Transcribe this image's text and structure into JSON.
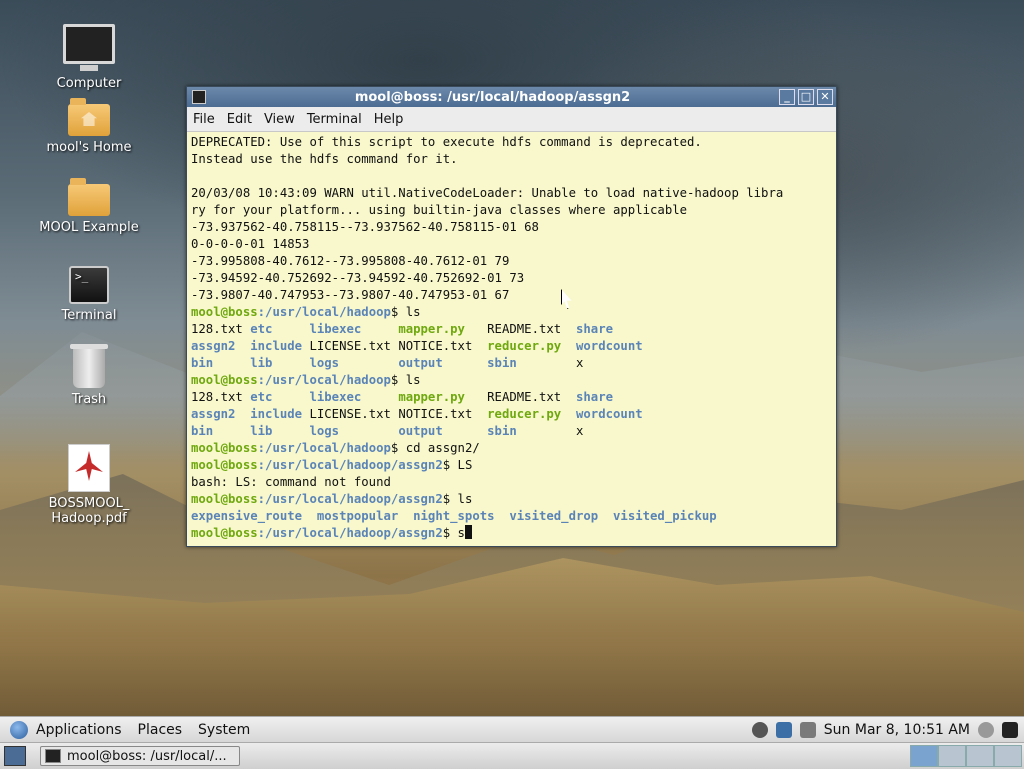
{
  "desktop": {
    "icons": [
      {
        "label": "Computer"
      },
      {
        "label": "mool's Home"
      },
      {
        "label": "MOOL Example"
      },
      {
        "label": "Terminal"
      },
      {
        "label": "Trash"
      },
      {
        "label": "BOSSMOOL_\nHadoop.pdf"
      }
    ]
  },
  "window": {
    "title": "mool@boss: /usr/local/hadoop/assgn2",
    "menu": [
      "File",
      "Edit",
      "View",
      "Terminal",
      "Help"
    ],
    "lines": [
      "DEPRECATED: Use of this script to execute hdfs command is deprecated.",
      "Instead use the hdfs command for it.",
      "",
      "20/03/08 10:43:09 WARN util.NativeCodeLoader: Unable to load native-hadoop libra",
      "ry for your platform... using builtin-java classes where applicable",
      "-73.937562-40.758115--73.937562-40.758115-01 68",
      "0-0-0-0-01 14853",
      "-73.995808-40.7612--73.995808-40.7612-01 79",
      "-73.94592-40.752692--73.94592-40.752692-01 73",
      "-73.9807-40.747953--73.9807-40.747953-01 67"
    ],
    "prompt_user": "mool@boss",
    "prompt_path1": ":/usr/local/hadoop",
    "prompt_path2": ":/usr/local/hadoop/assgn2",
    "cmd_ls": "$ ls",
    "cmd_cd": "$ cd assgn2/",
    "cmd_LS": "$ LS",
    "err_LS": "bash: LS: command not found",
    "cmd_cur": "$ s",
    "ls_hadoop": [
      [
        {
          "t": "128.txt ",
          "c": ""
        },
        {
          "t": "etc     ",
          "c": "b"
        },
        {
          "t": "libexec     ",
          "c": "b"
        },
        {
          "t": "mapper.py   ",
          "c": "g"
        },
        {
          "t": "README.txt  ",
          "c": ""
        },
        {
          "t": "share",
          "c": "b"
        }
      ],
      [
        {
          "t": "assgn2  ",
          "c": "b"
        },
        {
          "t": "include ",
          "c": "b"
        },
        {
          "t": "LICENSE.txt ",
          "c": ""
        },
        {
          "t": "NOTICE.txt  ",
          "c": ""
        },
        {
          "t": "reducer.py  ",
          "c": "g"
        },
        {
          "t": "wordcount",
          "c": "b"
        }
      ],
      [
        {
          "t": "bin     ",
          "c": "b"
        },
        {
          "t": "lib     ",
          "c": "b"
        },
        {
          "t": "logs        ",
          "c": "b"
        },
        {
          "t": "output      ",
          "c": "b"
        },
        {
          "t": "sbin        ",
          "c": "b"
        },
        {
          "t": "x",
          "c": ""
        }
      ]
    ],
    "ls_assgn2": [
      [
        {
          "t": "expensive_route  ",
          "c": "b"
        },
        {
          "t": "mostpopular  ",
          "c": "b"
        },
        {
          "t": "night_spots  ",
          "c": "b"
        },
        {
          "t": "visited_drop  ",
          "c": "b"
        },
        {
          "t": "visited_pickup",
          "c": "b"
        }
      ]
    ]
  },
  "panel": {
    "menus": [
      "Applications",
      "Places",
      "System"
    ],
    "clock": "Sun Mar  8, 10:51 AM",
    "task_label": "mool@boss: /usr/local/..."
  }
}
